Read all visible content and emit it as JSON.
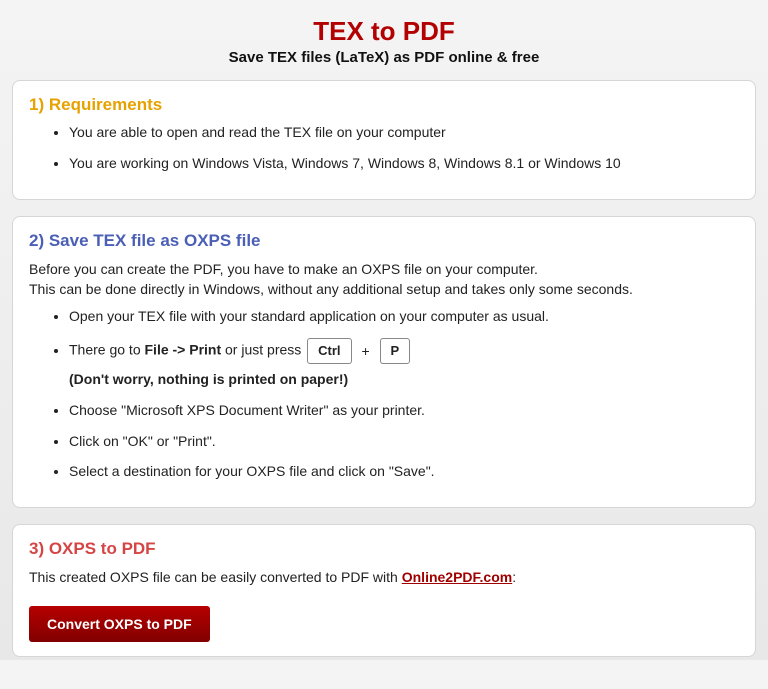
{
  "header": {
    "title": "TEX to PDF",
    "subtitle": "Save TEX files (LaTeX) as PDF online & free"
  },
  "section1": {
    "heading": "1) Requirements",
    "items": [
      "You are able to open and read the TEX file on your computer",
      "You are working on Windows Vista, Windows 7, Windows 8, Windows 8.1 or Windows 10"
    ]
  },
  "section2": {
    "heading": "2) Save TEX file as OXPS file",
    "intro1": "Before you can create the PDF, you have to make an OXPS file on your computer.",
    "intro2": "This can be done directly in Windows, without any additional setup and takes only some seconds.",
    "item1": "Open your TEX file with your standard application on your computer as usual.",
    "item2": {
      "prefix": "There go to ",
      "bold1": "File -> Print",
      "mid": " or just press ",
      "key1": "Ctrl",
      "plus": "+",
      "key2": "P",
      "note": "(Don't worry, nothing is printed on paper!)"
    },
    "item3": "Choose \"Microsoft XPS Document Writer\" as your printer.",
    "item4": "Click on \"OK\" or \"Print\".",
    "item5": "Select a destination for your OXPS file and click on \"Save\"."
  },
  "section3": {
    "heading": "3) OXPS to PDF",
    "text_before": "This created OXPS file can be easily converted to PDF with ",
    "link_text": "Online2PDF.com",
    "text_after": ":",
    "button": "Convert OXPS to PDF"
  }
}
